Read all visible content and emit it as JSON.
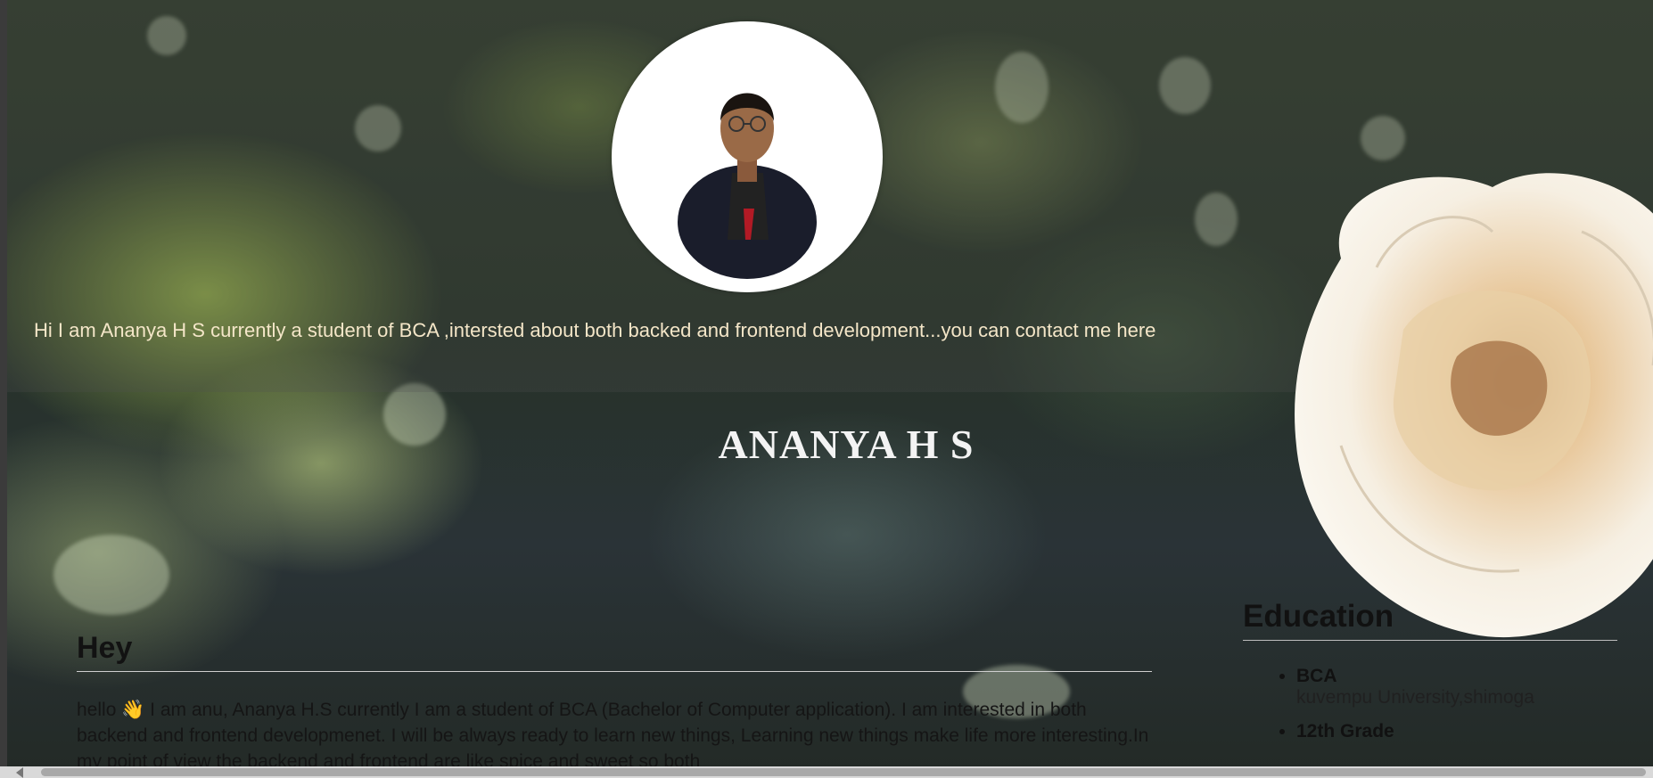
{
  "profile": {
    "photo_alt": "Profile photo",
    "intro": "Hi I am Ananya H S currently a student of BCA ,intersted about both backed and frontend development...you can contact me here",
    "name": "ANANYA H S"
  },
  "about": {
    "title": "Hey",
    "text": "hello 👋 I am anu, Ananya H.S currently I am a student of BCA (Bachelor of Computer application). I am interested in both backend and frontend developmenet. I will be always ready to learn new things, Learning new things make life more interesting.In my point of view the backend and frontend are like spice and sweet so both"
  },
  "education": {
    "title": "Education",
    "items": [
      {
        "degree": "BCA",
        "school": "kuvempu University,shimoga"
      },
      {
        "degree": "12th Grade",
        "school": ""
      }
    ]
  },
  "colors": {
    "intro_text": "#f4e6c8",
    "name_text": "#f3f3f3",
    "body_text": "#151515"
  }
}
